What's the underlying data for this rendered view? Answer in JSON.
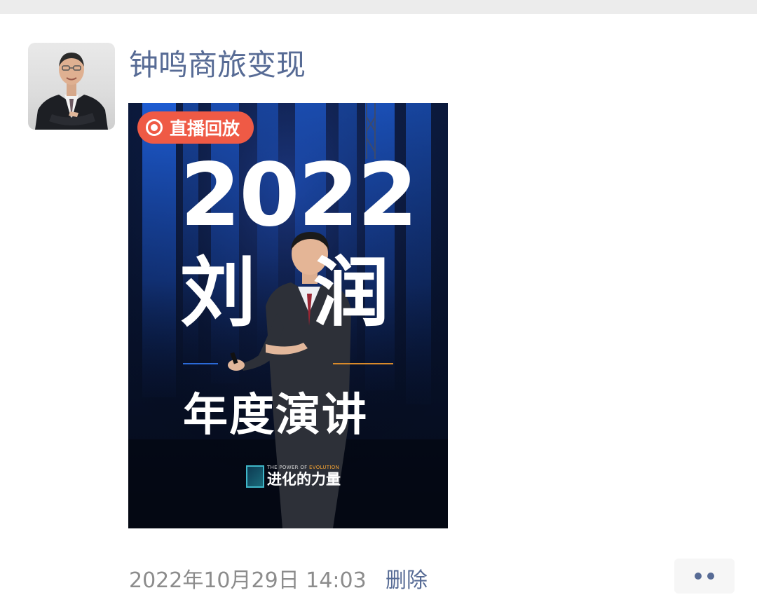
{
  "post": {
    "author_name": "钟鸣商旅变现",
    "timestamp": "2022年10月29日 14:03",
    "delete_label": "删除"
  },
  "poster": {
    "badge_label": "直播回放",
    "year": "2022",
    "name_char_1": "刘",
    "name_char_2": "润",
    "subtitle": "年度演讲",
    "brand_en_prefix": "THE POWER OF ",
    "brand_en_highlight": "EVOLUTION",
    "brand_cn": "进化的力量"
  },
  "colors": {
    "link": "#576b95",
    "badge": "#ef5a45",
    "meta_gray": "#8c8c8c"
  },
  "icons": {
    "more": "more-options-icon",
    "record": "record-icon"
  }
}
